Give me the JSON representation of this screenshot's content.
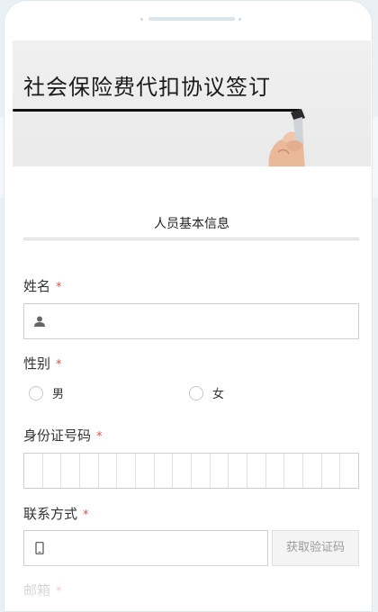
{
  "banner": {
    "title": "社会保险费代扣协议签订"
  },
  "section": {
    "title": "人员基本信息"
  },
  "form": {
    "required_mark": "*",
    "name": {
      "label": "姓名",
      "value": ""
    },
    "gender": {
      "label": "性别",
      "options": [
        "男",
        "女"
      ],
      "selected": ""
    },
    "id_number": {
      "label": "身份证号码",
      "digits": 18
    },
    "contact": {
      "label": "联系方式",
      "value": "",
      "code_button": "获取验证码"
    },
    "email": {
      "label": "邮箱"
    }
  },
  "colors": {
    "required": "#d9534f",
    "border": "#cfcfcf",
    "button_bg": "#f4f4f4"
  }
}
